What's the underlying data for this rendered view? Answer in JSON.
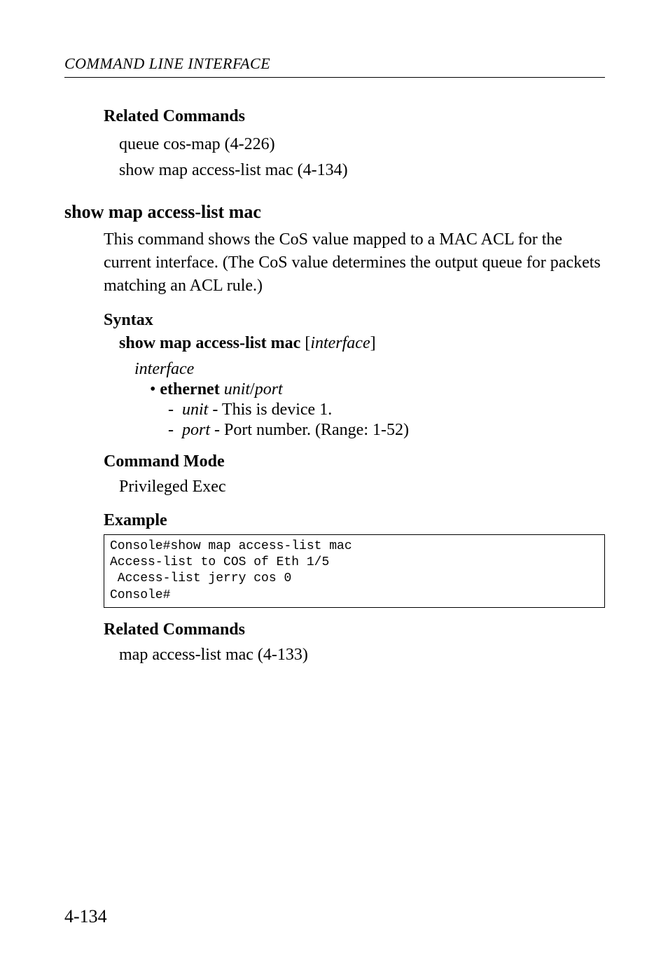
{
  "running_head": "COMMAND LINE INTERFACE",
  "sections": {
    "related1": {
      "heading": "Related Commands",
      "lines": [
        "queue cos-map (4-226)",
        "show map access-list mac (4-134)"
      ]
    },
    "cmd": {
      "title": "show map access-list mac",
      "desc": "This command shows the CoS value mapped to a MAC ACL for the current interface. (The CoS value determines the output queue for packets matching an ACL rule.)"
    },
    "syntax": {
      "heading": "Syntax",
      "bold": "show map access-list mac",
      "bracket_open": " [",
      "italic": "interface",
      "bracket_close": "]",
      "interface_word": "interface",
      "ethernet_label": "ethernet",
      "unit_word": "unit",
      "slash": "/",
      "port_word": "port",
      "unit_desc_prefix": " - ",
      "unit_desc": "This is device 1.",
      "port_desc": "Port number. (Range: 1-52)"
    },
    "mode": {
      "heading": "Command Mode",
      "value": "Privileged Exec"
    },
    "example": {
      "heading": "Example",
      "console": "Console#show map access-list mac\nAccess-list to COS of Eth 1/5\n Access-list jerry cos 0\nConsole#"
    },
    "related2": {
      "heading": "Related Commands",
      "line": "map access-list mac (4-133)"
    }
  },
  "page_number": "4-134"
}
